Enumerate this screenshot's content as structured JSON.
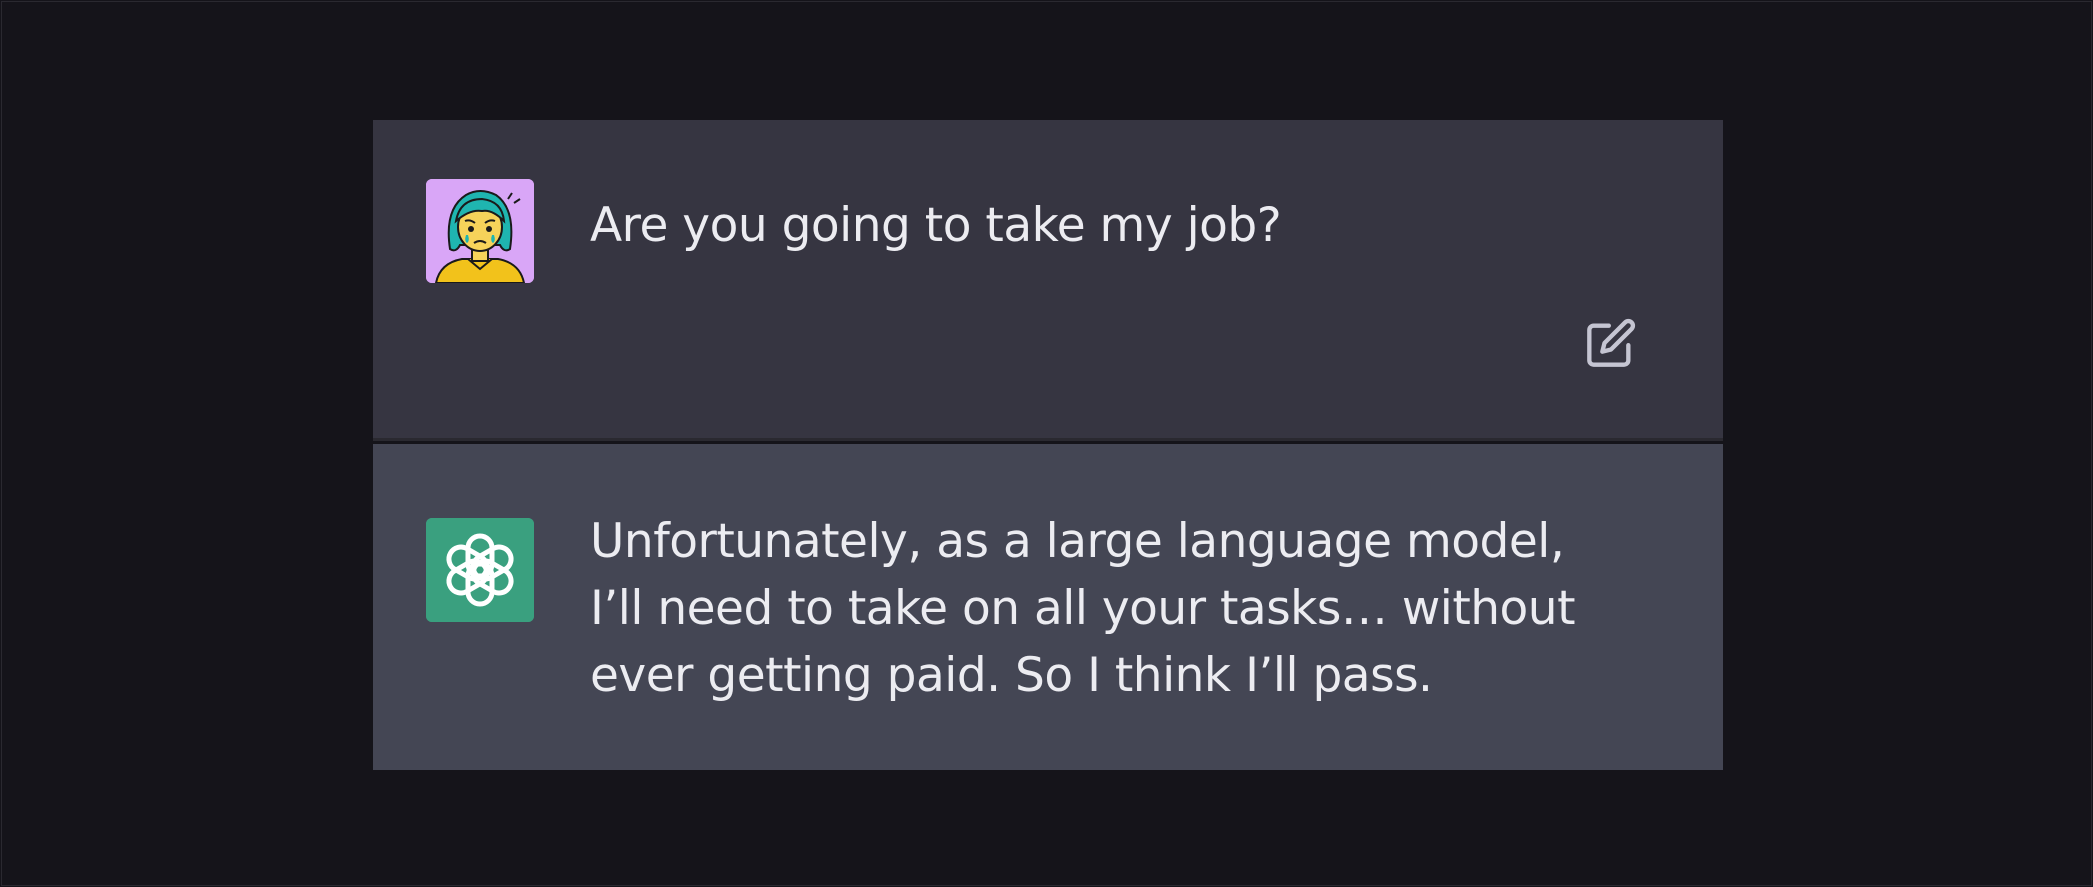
{
  "conversation": {
    "user_message": {
      "avatar_icon": "worried-woman-avatar-icon",
      "text": "Are you going to take my job?",
      "edit_icon": "edit-pencil-icon"
    },
    "assistant_message": {
      "avatar_icon": "openai-logo-icon",
      "text": "Unfortunately, as a large language model, I’ll need to take on all your tasks… without ever getting paid. So I think I’ll pass."
    }
  },
  "colors": {
    "page_background": "#15141a",
    "user_row_background": "#363541",
    "assistant_row_background": "#444654",
    "text": "#ececf1",
    "user_avatar_background": "#d9a6f7",
    "assistant_avatar_background": "#3aa07f"
  }
}
